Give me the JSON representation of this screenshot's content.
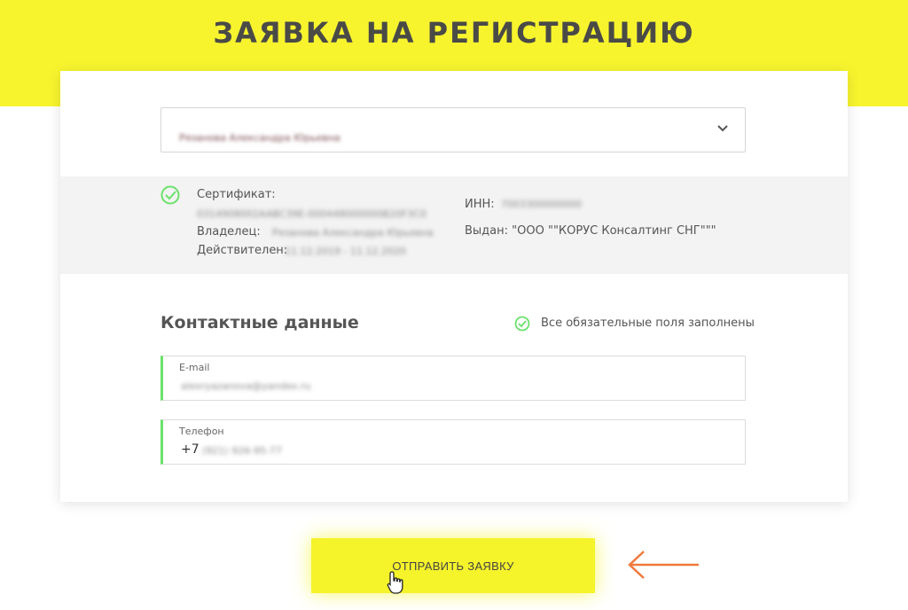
{
  "header": {
    "title": "ЗАЯВКА НА РЕГИСТРАЦИЮ"
  },
  "selector": {
    "value": "Рязанова Александра Юрьевна"
  },
  "certificate": {
    "cert_label": "Сертификат:",
    "cert_value": "0314908002AABC39E-000448000000B20F3C0",
    "owner_label": "Владелец:",
    "owner_value": "Рязанова Александра Юрьевна",
    "valid_label": "Действителен:",
    "valid_value": "11.12.2019 - 11.12.2020",
    "inn_label": "ИНН:",
    "inn_value": "7003300000000",
    "issuer_text": "Выдан: \"ООО \"\"КОРУС Консалтинг СНГ\"\"\""
  },
  "contacts": {
    "title": "Контактные данные",
    "status": "Все обязательные поля заполнены",
    "email_label": "E-mail",
    "email_value": "alexryazanova@yandex.ru",
    "phone_label": "Телефон",
    "phone_prefix": "+7",
    "phone_value": "(921) 926-95-77"
  },
  "submit": {
    "label": "ОТПРАВИТЬ ЗАЯВКУ"
  },
  "colors": {
    "accent_yellow": "#f7f42e",
    "success_green": "#6be26b",
    "arrow_orange": "#f07a3c"
  }
}
